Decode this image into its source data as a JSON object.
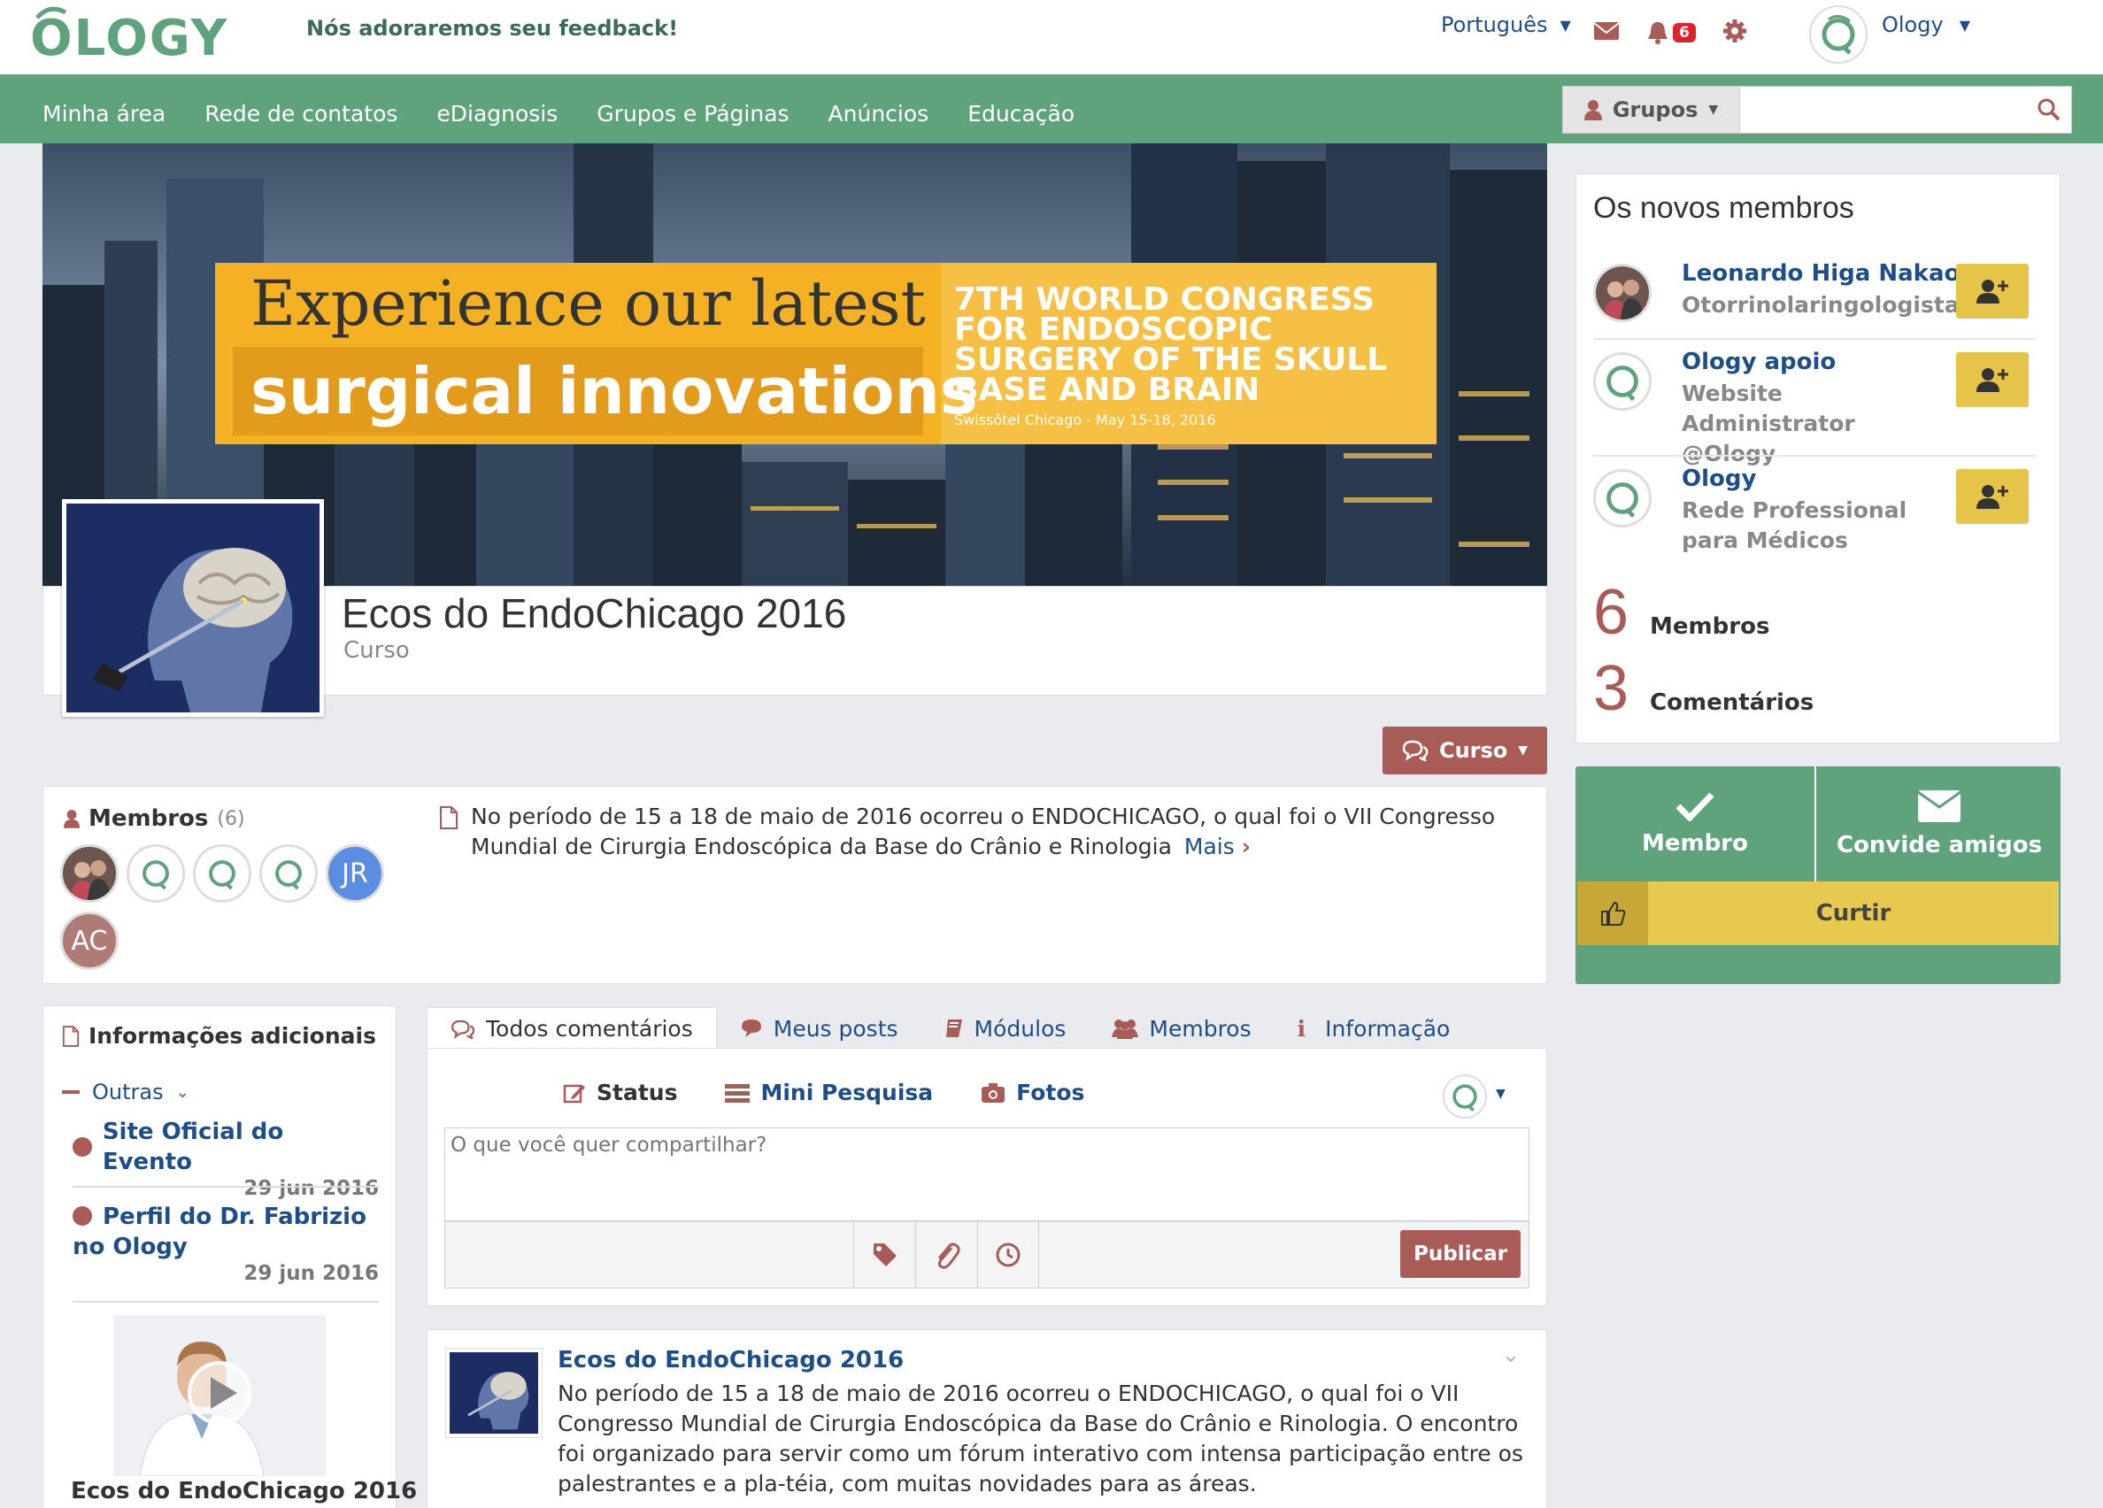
{
  "header": {
    "logo_text": "OLOGY",
    "tagline": "Nós adoraremos seu feedback!",
    "language": "Português",
    "notifications_count": "6",
    "user_name": "Ology"
  },
  "nav": {
    "items": [
      "Minha área",
      "Rede de contatos",
      "eDiagnosis",
      "Grupos e Páginas",
      "Anúncios",
      "Educação"
    ],
    "search_scope": "Grupos",
    "search_placeholder": ""
  },
  "banner": {
    "line1": "Experience our latest",
    "line2": "surgical innovations",
    "congress": [
      "7TH WORLD CONGRESS",
      "FOR ENDOSCOPIC",
      "SURGERY OF THE SKULL",
      "BASE AND BRAIN"
    ],
    "venue": "Swissôtel Chicago - May 15-18, 2016"
  },
  "group": {
    "title": "Ecos do EndoChicago 2016",
    "subtitle": "Curso",
    "action_button": "Curso"
  },
  "members": {
    "label": "Membros",
    "count": "(6)",
    "initials": [
      "JR",
      "AC"
    ],
    "description": "No período de 15 a 18 de maio de 2016 ocorreu o ENDOCHICAGO, o qual foi o VII Congresso Mundial de Cirurgia Endoscópica da Base do Crânio e Rinologia",
    "more": "Mais"
  },
  "info": {
    "heading": "Informações adicionais",
    "category": "Outras",
    "links": [
      {
        "title": "Site Oficial do Evento",
        "date": "29 jun 2016"
      },
      {
        "title": "Perfil do Dr. Fabrizio no Ology",
        "date": "29 jun 2016"
      }
    ],
    "video_title": "Ecos do EndoChicago 2016"
  },
  "tabs": [
    "Todos comentários",
    "Meus posts",
    "Módulos",
    "Membros",
    "Informação"
  ],
  "composer": {
    "tabs": [
      "Status",
      "Mini Pesquisa",
      "Fotos"
    ],
    "placeholder": "O que você quer compartilhar?",
    "submit": "Publicar"
  },
  "post": {
    "title": "Ecos do EndoChicago 2016",
    "text": "No período de 15 a 18 de maio de 2016 ocorreu o ENDOCHICAGO, o qual foi o VII Congresso Mundial de Cirurgia Endoscópica da Base do Crânio e Rinologia. O encontro foi organizado para servir como um fórum interativo com intensa participação entre os palestrantes e a pla-téia, com muitas novidades para as áreas."
  },
  "new_members": {
    "heading": "Os novos membros",
    "list": [
      {
        "name": "Leonardo Higa Nakao",
        "role": "Otorrinolaringologista"
      },
      {
        "name": "Ology apoio",
        "role": "Website Administrator @Ology"
      },
      {
        "name": "Ology",
        "role": "Rede Professional para Médicos"
      }
    ],
    "stats": [
      {
        "value": "6",
        "label": "Membros"
      },
      {
        "value": "3",
        "label": "Comentários"
      }
    ]
  },
  "actions": {
    "member": "Membro",
    "invite": "Convide amigos",
    "like": "Curtir"
  },
  "colors": {
    "green": "#5fa37d",
    "brown": "#a95c57",
    "yellow": "#e6c349",
    "link": "#1d4e89"
  }
}
